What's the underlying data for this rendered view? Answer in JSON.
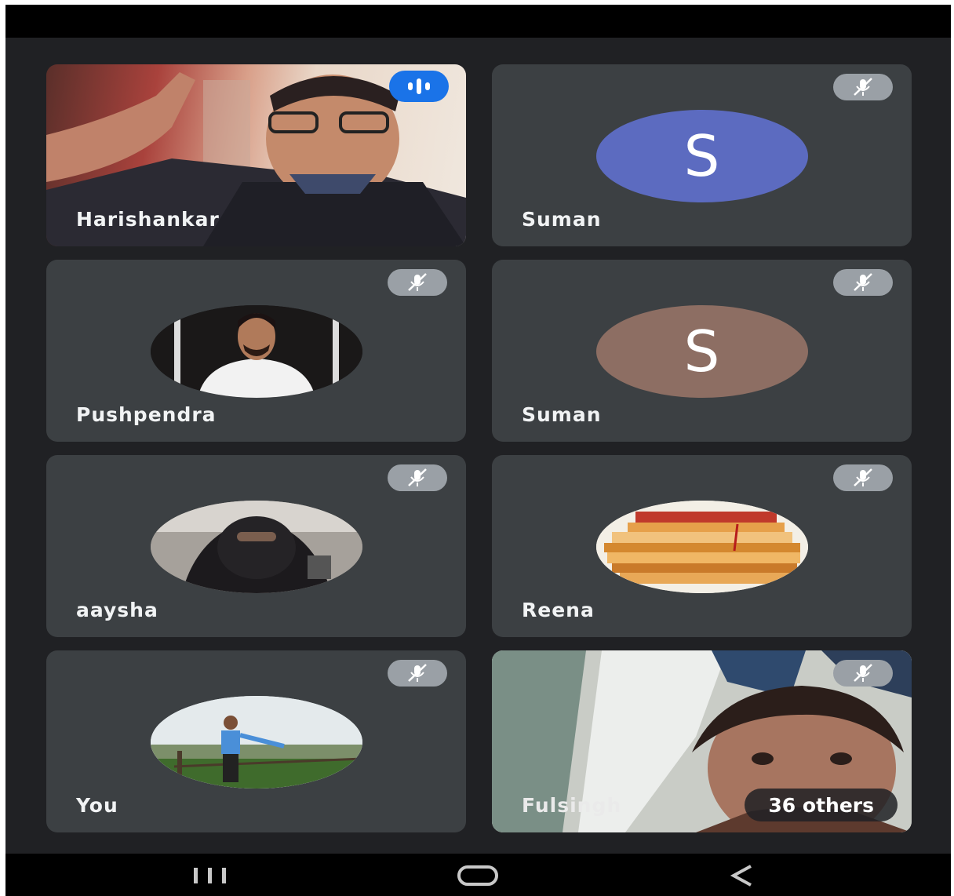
{
  "participants": [
    {
      "name": "Harishankar",
      "kind": "video",
      "speaking": true
    },
    {
      "name": "Suman",
      "kind": "initial",
      "initial": "S",
      "color": "#5c6bc0",
      "muted": true
    },
    {
      "name": "Pushpendra",
      "kind": "photo",
      "muted": true
    },
    {
      "name": "Suman",
      "kind": "initial",
      "initial": "S",
      "color": "#8d6e63",
      "muted": true
    },
    {
      "name": "aaysha",
      "kind": "photo",
      "muted": true
    },
    {
      "name": "Reena",
      "kind": "photo",
      "muted": true
    },
    {
      "name": "You",
      "kind": "photo",
      "muted": true
    },
    {
      "name": "Fulsingh",
      "kind": "video",
      "muted": true
    }
  ],
  "others_label": "36 others",
  "icons": {
    "mute": "mic-off-icon",
    "speaking": "audio-level-icon",
    "nav": [
      "recent-apps-icon",
      "home-icon",
      "back-icon"
    ]
  },
  "colors": {
    "background": "#202124",
    "tile": "#3c4043",
    "speaking_badge": "#1a73e8"
  }
}
